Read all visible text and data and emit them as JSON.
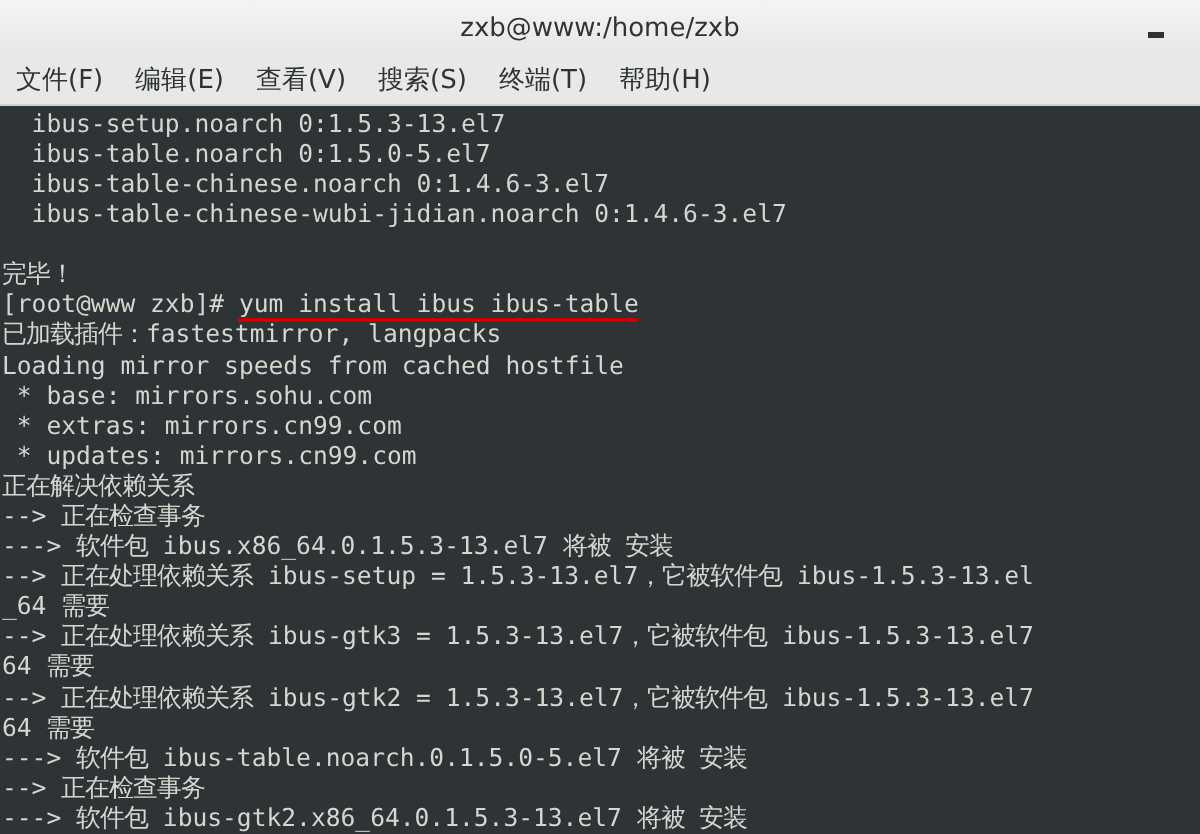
{
  "window": {
    "title": "zxb@www:/home/zxb"
  },
  "menu": [
    {
      "label": "文件(F)"
    },
    {
      "label": "编辑(E)"
    },
    {
      "label": "查看(V)"
    },
    {
      "label": "搜索(S)"
    },
    {
      "label": "终端(T)"
    },
    {
      "label": "帮助(H)"
    }
  ],
  "terminal": {
    "lines": [
      {
        "kind": "output",
        "text": "  ibus-setup.noarch 0:1.5.3-13.el7"
      },
      {
        "kind": "output",
        "text": "  ibus-table.noarch 0:1.5.0-5.el7"
      },
      {
        "kind": "output",
        "text": "  ibus-table-chinese.noarch 0:1.4.6-3.el7"
      },
      {
        "kind": "output",
        "text": "  ibus-table-chinese-wubi-jidian.noarch 0:1.4.6-3.el7"
      },
      {
        "kind": "blank"
      },
      {
        "kind": "output",
        "text": "完毕！"
      },
      {
        "kind": "prompt",
        "prompt": "[root@www zxb]#",
        "command": "yum install ibus ibus-table",
        "underlined": true
      },
      {
        "kind": "output",
        "text": "已加载插件：fastestmirror, langpacks"
      },
      {
        "kind": "output",
        "text": "Loading mirror speeds from cached hostfile"
      },
      {
        "kind": "output",
        "text": " * base: mirrors.sohu.com"
      },
      {
        "kind": "output",
        "text": " * extras: mirrors.cn99.com"
      },
      {
        "kind": "output",
        "text": " * updates: mirrors.cn99.com"
      },
      {
        "kind": "output",
        "text": "正在解决依赖关系"
      },
      {
        "kind": "output",
        "text": "--> 正在检查事务"
      },
      {
        "kind": "output",
        "text": "---> 软件包 ibus.x86_64.0.1.5.3-13.el7 将被 安装"
      },
      {
        "kind": "output",
        "text": "--> 正在处理依赖关系 ibus-setup = 1.5.3-13.el7，它被软件包 ibus-1.5.3-13.el"
      },
      {
        "kind": "output",
        "text": "_64 需要"
      },
      {
        "kind": "output",
        "text": "--> 正在处理依赖关系 ibus-gtk3 = 1.5.3-13.el7，它被软件包 ibus-1.5.3-13.el7"
      },
      {
        "kind": "output",
        "text": "64 需要"
      },
      {
        "kind": "output",
        "text": "--> 正在处理依赖关系 ibus-gtk2 = 1.5.3-13.el7，它被软件包 ibus-1.5.3-13.el7"
      },
      {
        "kind": "output",
        "text": "64 需要"
      },
      {
        "kind": "output",
        "text": "---> 软件包 ibus-table.noarch.0.1.5.0-5.el7 将被 安装"
      },
      {
        "kind": "output",
        "text": "--> 正在检查事务"
      },
      {
        "kind": "output",
        "text": "---> 软件包 ibus-gtk2.x86_64.0.1.5.3-13.el7 将被 安装"
      }
    ]
  }
}
